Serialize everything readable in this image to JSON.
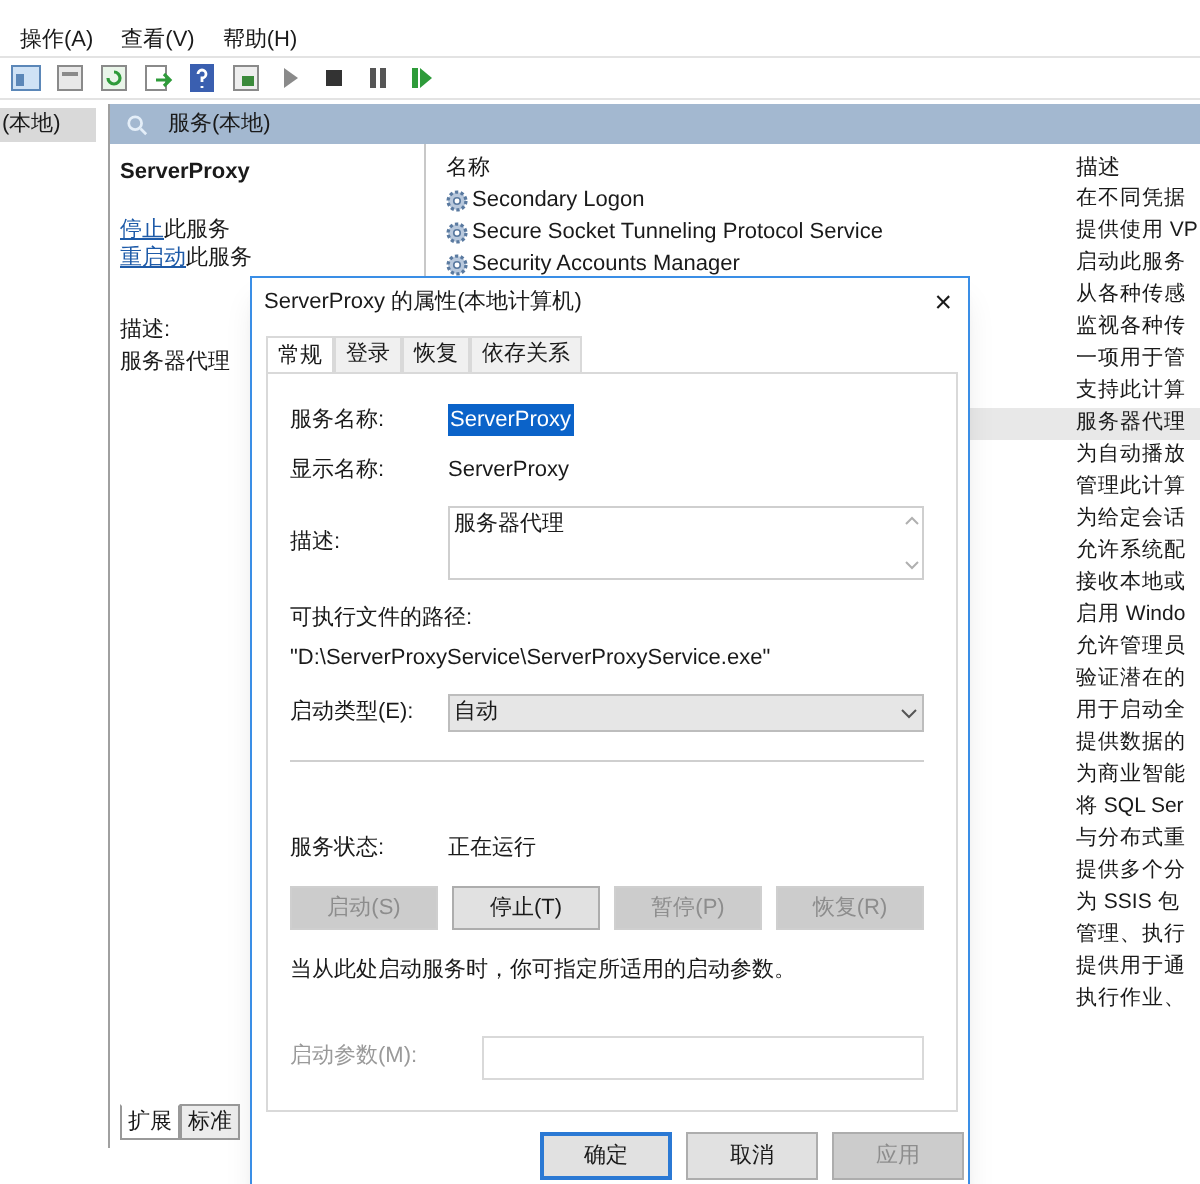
{
  "menu": [
    {
      "label": "操作(A)"
    },
    {
      "label": "查看(V)"
    },
    {
      "label": "帮助(H)"
    }
  ],
  "tree": [
    {
      "label": "(本地)",
      "selected": true
    }
  ],
  "panel_header": "服务(本地)",
  "detail": {
    "service_name": "ServerProxy",
    "actions": [
      {
        "link": "停止",
        "rest": "此服务"
      },
      {
        "link": "重启动",
        "rest": "此服务"
      }
    ],
    "description_label": "描述:",
    "description": "服务器代理"
  },
  "view_tabs": [
    {
      "label": "扩展",
      "selected": true
    },
    {
      "label": "标准",
      "selected": false
    }
  ],
  "list": {
    "columns": [
      "名称",
      "描述"
    ],
    "rows": [
      {
        "name": "Secondary Logon",
        "description": "在不同凭据",
        "selected": false
      },
      {
        "name": "Secure Socket Tunneling Protocol Service",
        "description": "提供使用 VP",
        "selected": false
      },
      {
        "name": "Security Accounts Manager",
        "description": "启动此服务",
        "selected": false
      },
      {
        "description": "从各种传感",
        "selected": false
      },
      {
        "description": "监视各种传",
        "selected": false
      },
      {
        "description": "一项用于管",
        "selected": false
      },
      {
        "description": "支持此计算",
        "selected": false
      },
      {
        "description": "服务器代理",
        "selected": true
      },
      {
        "description": "为自动播放",
        "selected": false
      },
      {
        "description": "管理此计算",
        "selected": false
      },
      {
        "description": "为给定会话",
        "selected": false
      },
      {
        "description": "允许系统配",
        "selected": false
      },
      {
        "description": "接收本地或",
        "selected": false
      },
      {
        "description": "启用 Windo",
        "selected": false
      },
      {
        "description": "允许管理员",
        "selected": false
      },
      {
        "description": "验证潜在的",
        "selected": false
      },
      {
        "description": "用于启动全",
        "selected": false
      },
      {
        "description": "提供数据的",
        "selected": false
      },
      {
        "description": "为商业智能",
        "selected": false
      },
      {
        "description": "将 SQL Ser",
        "selected": false
      },
      {
        "description": "与分布式重",
        "selected": false
      },
      {
        "description": "提供多个分",
        "selected": false
      },
      {
        "description": "为 SSIS 包",
        "selected": false
      },
      {
        "description": "管理、执行",
        "selected": false
      },
      {
        "description": "提供用于通",
        "selected": false
      },
      {
        "description": "执行作业、",
        "selected": false
      }
    ]
  },
  "dialog": {
    "title": "ServerProxy 的属性(本地计算机)",
    "close": "×",
    "tabs": [
      {
        "label": "常规",
        "selected": true
      },
      {
        "label": "登录",
        "selected": false
      },
      {
        "label": "恢复",
        "selected": false
      },
      {
        "label": "依存关系",
        "selected": false
      }
    ],
    "service_name_label": "服务名称:",
    "service_name": "ServerProxy",
    "display_name_label": "显示名称:",
    "display_name": "ServerProxy",
    "description_label": "描述:",
    "description": "服务器代理",
    "path_label": "可执行文件的路径:",
    "path": "\"D:\\ServerProxyService\\ServerProxyService.exe\"",
    "startup_type_label": "启动类型(E):",
    "startup_type": "自动",
    "status_label": "服务状态:",
    "status": "正在运行",
    "control_buttons": [
      {
        "label": "启动(S)",
        "disabled": true
      },
      {
        "label": "停止(T)",
        "disabled": false
      },
      {
        "label": "暂停(P)",
        "disabled": true
      },
      {
        "label": "恢复(R)",
        "disabled": true
      }
    ],
    "hint": "当从此处启动服务时，你可指定所适用的启动参数。",
    "parameters_label": "启动参数(M):",
    "parameters_disabled": true,
    "buttons": [
      {
        "label": "确定",
        "default": true,
        "disabled": false
      },
      {
        "label": "取消",
        "default": false,
        "disabled": false
      },
      {
        "label": "应用",
        "default": false,
        "disabled": true
      }
    ]
  }
}
